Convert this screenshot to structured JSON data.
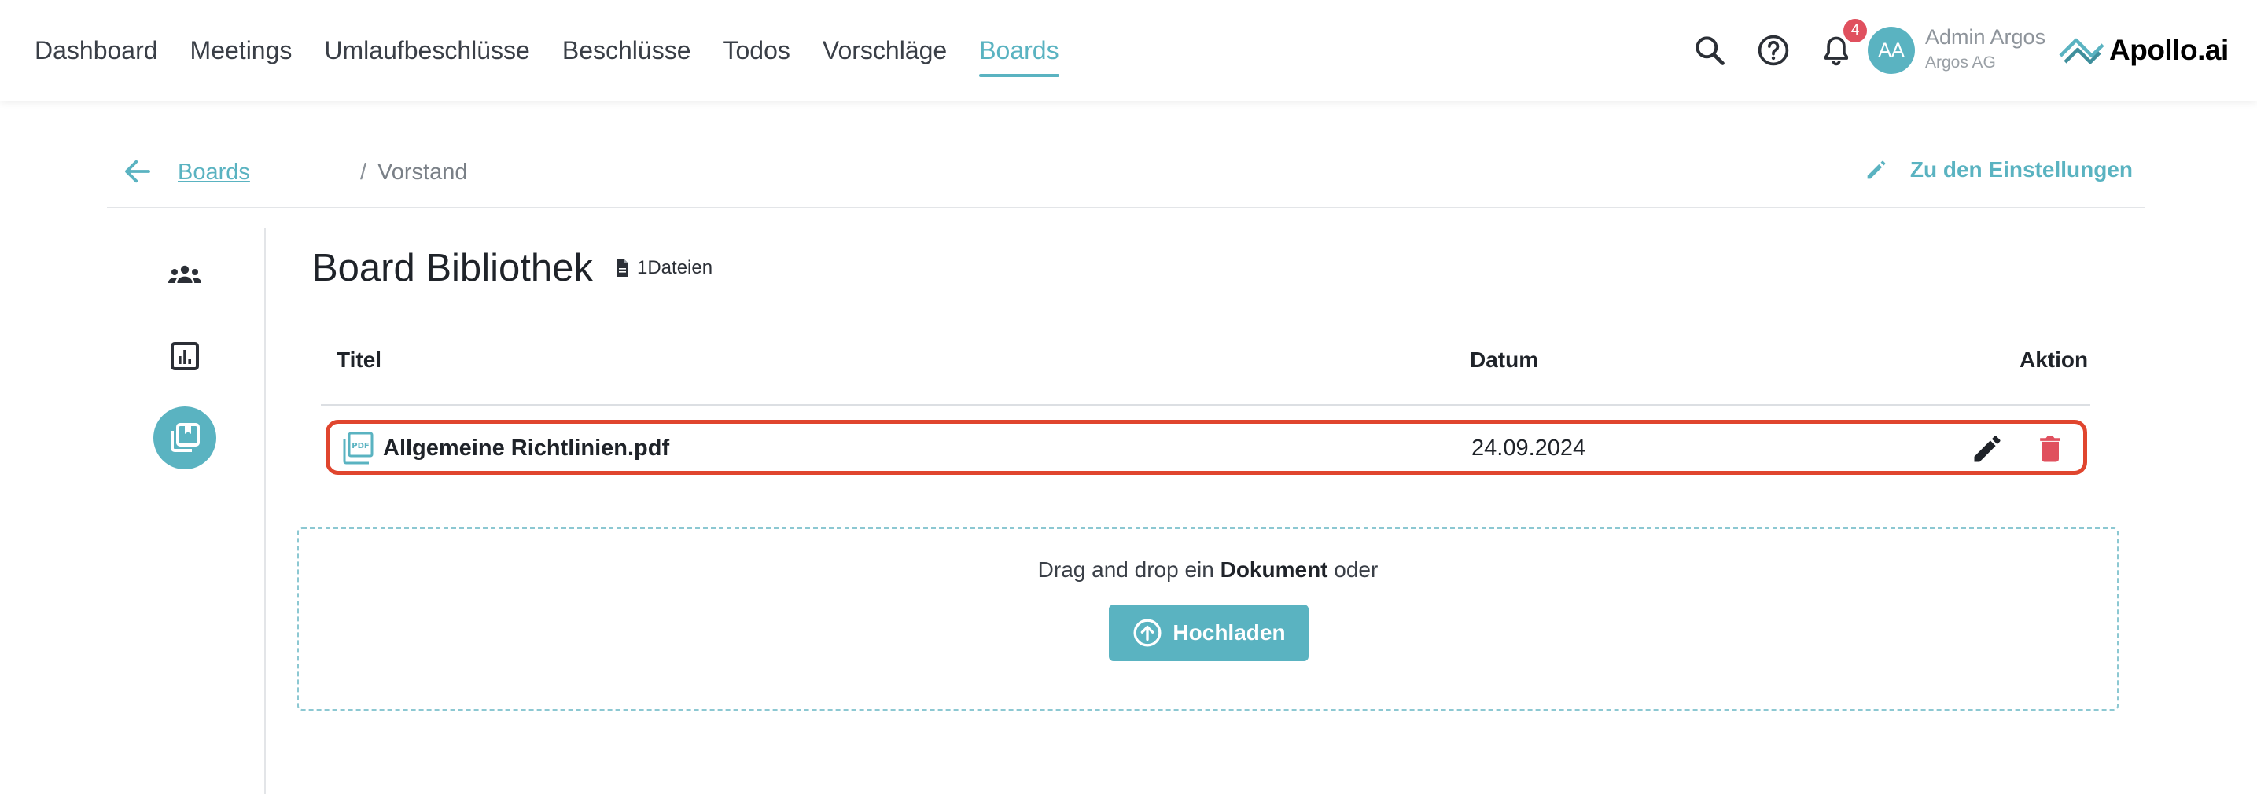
{
  "nav": {
    "items": [
      {
        "label": "Dashboard",
        "active": false
      },
      {
        "label": "Meetings",
        "active": false
      },
      {
        "label": "Umlaufbeschlüsse",
        "active": false
      },
      {
        "label": "Beschlüsse",
        "active": false
      },
      {
        "label": "Todos",
        "active": false
      },
      {
        "label": "Vorschläge",
        "active": false
      },
      {
        "label": "Boards",
        "active": true
      }
    ]
  },
  "topbar": {
    "notification_count": "4",
    "avatar_initials": "AA",
    "user_name": "Admin Argos",
    "user_org": "Argos AG",
    "logo_text": "Apollo.ai"
  },
  "breadcrumb": {
    "parent": "Boards",
    "separator": "/",
    "current": "Vorstand",
    "settings_label": "Zu den Einstellungen"
  },
  "library": {
    "title": "Board Bibliothek",
    "file_count": "1Dateien",
    "columns": {
      "title": "Titel",
      "date": "Datum",
      "action": "Aktion"
    },
    "files": [
      {
        "title": "Allgemeine Richtlinien.pdf",
        "date": "24.09.2024"
      }
    ]
  },
  "dropzone": {
    "text_before": "Drag and drop ein ",
    "text_bold": "Dokument",
    "text_after": " oder",
    "upload_label": "Hochladen"
  },
  "colors": {
    "accent": "#5ab3c1",
    "badge": "#e0505e",
    "delete": "#e0505e",
    "highlight": "#e0452e"
  }
}
